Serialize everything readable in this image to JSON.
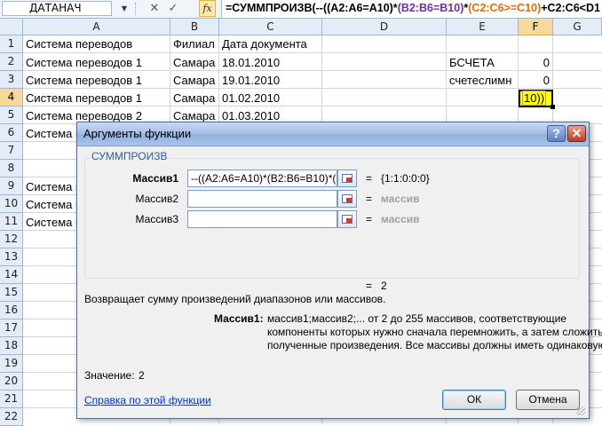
{
  "formula_bar": {
    "name_box": "ДАТАНАЧ",
    "name_box_arrow": "▼",
    "cancel_glyph": "✕",
    "enter_glyph": "✓",
    "fx_label": "fx",
    "formula_part1": "=СУММПРОИЗВ(--((A2:A6=A10)*",
    "formula_part2": "(B2:B6=B10)",
    "formula_part3": "*",
    "formula_part4": "(C2:C6>=C10)",
    "formula_part5": "+C2:C6<D1"
  },
  "sheet": {
    "columns": [
      "A",
      "B",
      "C",
      "D",
      "E",
      "F",
      "G"
    ],
    "rows": [
      "1",
      "2",
      "3",
      "4",
      "5",
      "6",
      "7",
      "8",
      "9",
      "10",
      "11",
      "12",
      "13",
      "14",
      "15",
      "16",
      "17",
      "18",
      "19",
      "20",
      "21",
      "22"
    ],
    "cells": {
      "A1": "Система переводов",
      "B1": "Филиал",
      "C1": "Дата документа",
      "A2": "Система переводов 1",
      "B2": "Самара",
      "C2": "18.01.2010",
      "E2": "БСЧЕТА",
      "F2": "0",
      "A3": "Система переводов 1",
      "B3": "Самара",
      "C3": "19.01.2010",
      "E3": "счетеслимн",
      "F3": "0",
      "A4": "Система переводов 1",
      "B4": "Самара",
      "C4": "01.02.2010",
      "A5": "Система переводов 2",
      "B5": "Самара",
      "C5": "01.03.2010",
      "A6": "Система п",
      "A9": "Система п",
      "A10": "Система п",
      "A11": "Система п"
    },
    "active_cell_text": "10))"
  },
  "dialog": {
    "title": "Аргументы функции",
    "help_glyph": "?",
    "close_glyph": "✕",
    "function_name": "СУММПРОИЗВ",
    "args": [
      {
        "label": "Массив1",
        "value": "--((A2:A6=A10)*(B2:B6=B10)*(C",
        "result": "{1:1:0:0:0}"
      },
      {
        "label": "Массив2",
        "value": "",
        "result": "массив"
      },
      {
        "label": "Массив3",
        "value": "",
        "result": "массив"
      }
    ],
    "equals": "=",
    "total_result": "2",
    "description": "Возвращает сумму произведений диапазонов или массивов.",
    "arg_desc_label": "Массив1:",
    "arg_desc_lines": [
      "массив1;массив2;... от 2 до 255 массивов, соответствующие",
      "компоненты которых нужно сначала перемножить, а затем сложить",
      "полученные произведения. Все массивы должны иметь одинаковую"
    ],
    "value_label": "Значение:",
    "value": "2",
    "help_link": "Справка по этой функции",
    "ok_label": "ОК",
    "cancel_label": "Отмена"
  }
}
